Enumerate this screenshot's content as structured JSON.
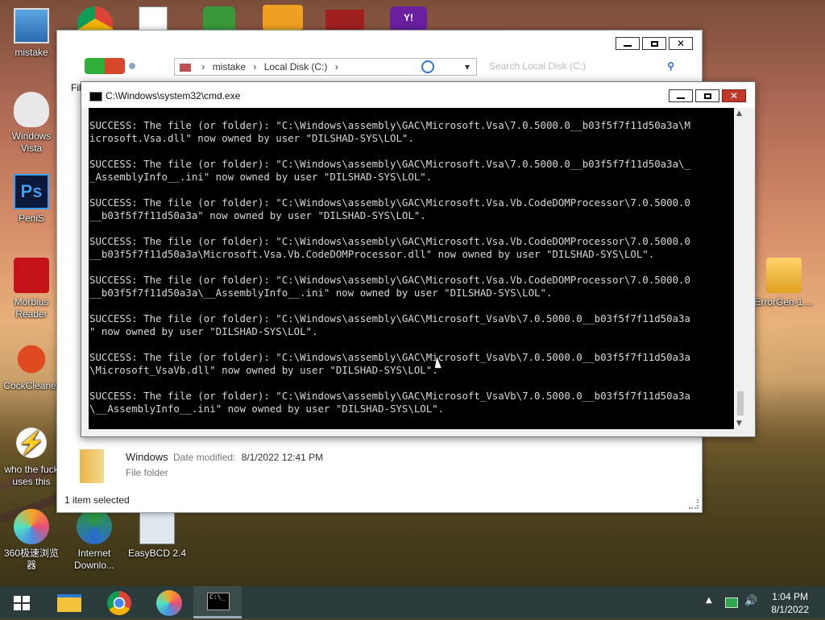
{
  "desktop_icons": [
    {
      "label": "mistake",
      "icon": "computer-icon"
    },
    {
      "label": "Windows Vista",
      "icon": "vista-mascot-icon"
    },
    {
      "label": "PeniS",
      "icon": "photoshop-icon"
    },
    {
      "label": "Morbius Reader",
      "icon": "pdf-reader-icon"
    },
    {
      "label": "CockCleaner",
      "icon": "ccleaner-icon"
    },
    {
      "label": "who the fuck uses this",
      "icon": "lightning-icon"
    },
    {
      "label": "360极速浏览器",
      "icon": "360-browser-icon"
    },
    {
      "label": "Internet Downlo...",
      "icon": "idm-icon"
    },
    {
      "label": "EasyBCD 2.4",
      "icon": "easybcd-icon"
    },
    {
      "label": "ErrorGen-1....",
      "icon": "errorgen-icon"
    }
  ],
  "explorer": {
    "breadcrumb": [
      "mistake",
      "Local Disk (C:)"
    ],
    "search_placeholder": "Search Local Disk (C:)",
    "menu_partial": "Fil",
    "file": {
      "name": "Windows",
      "modified_label": "Date modified:",
      "modified": "8/1/2022 12:41 PM",
      "type": "File folder"
    },
    "status": "1 item selected"
  },
  "cmd": {
    "title": "C:\\Windows\\system32\\cmd.exe",
    "output": [
      "SUCCESS: The file (or folder): \"C:\\Windows\\assembly\\GAC\\Microsoft.Vsa\\7.0.5000.0__b03f5f7f11d50a3a\\M",
      "icrosoft.Vsa.dll\" now owned by user \"DILSHAD-SYS\\LOL\".",
      "",
      "SUCCESS: The file (or folder): \"C:\\Windows\\assembly\\GAC\\Microsoft.Vsa\\7.0.5000.0__b03f5f7f11d50a3a\\_",
      "_AssemblyInfo__.ini\" now owned by user \"DILSHAD-SYS\\LOL\".",
      "",
      "SUCCESS: The file (or folder): \"C:\\Windows\\assembly\\GAC\\Microsoft.Vsa.Vb.CodeDOMProcessor\\7.0.5000.0",
      "__b03f5f7f11d50a3a\" now owned by user \"DILSHAD-SYS\\LOL\".",
      "",
      "SUCCESS: The file (or folder): \"C:\\Windows\\assembly\\GAC\\Microsoft.Vsa.Vb.CodeDOMProcessor\\7.0.5000.0",
      "__b03f5f7f11d50a3a\\Microsoft.Vsa.Vb.CodeDOMProcessor.dll\" now owned by user \"DILSHAD-SYS\\LOL\".",
      "",
      "SUCCESS: The file (or folder): \"C:\\Windows\\assembly\\GAC\\Microsoft.Vsa.Vb.CodeDOMProcessor\\7.0.5000.0",
      "__b03f5f7f11d50a3a\\__AssemblyInfo__.ini\" now owned by user \"DILSHAD-SYS\\LOL\".",
      "",
      "SUCCESS: The file (or folder): \"C:\\Windows\\assembly\\GAC\\Microsoft_VsaVb\\7.0.5000.0__b03f5f7f11d50a3a",
      "\" now owned by user \"DILSHAD-SYS\\LOL\".",
      "",
      "SUCCESS: The file (or folder): \"C:\\Windows\\assembly\\GAC\\Microsoft_VsaVb\\7.0.5000.0__b03f5f7f11d50a3a",
      "\\Microsoft_VsaVb.dll\" now owned by user \"DILSHAD-SYS\\LOL\".",
      "",
      "SUCCESS: The file (or folder): \"C:\\Windows\\assembly\\GAC\\Microsoft_VsaVb\\7.0.5000.0__b03f5f7f11d50a3a",
      "\\__AssemblyInfo__.ini\" now owned by user \"DILSHAD-SYS\\LOL\"."
    ]
  },
  "taskbar": {
    "pinned": [
      "start-icon",
      "file-explorer-icon",
      "chrome-icon",
      "360-browser-icon",
      "cmd-icon"
    ],
    "time": "1:04 PM",
    "date": "8/1/2022"
  }
}
